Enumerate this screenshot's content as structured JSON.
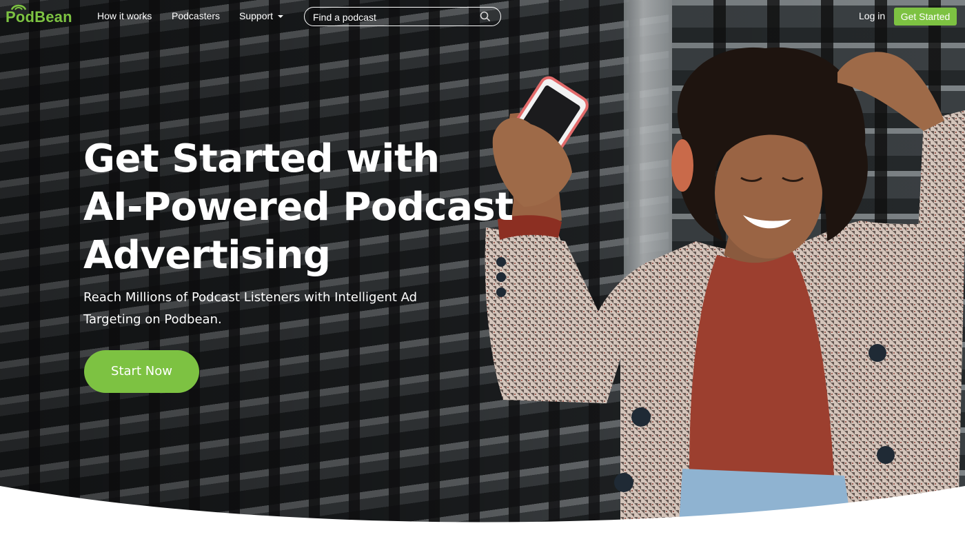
{
  "brand": {
    "name": "PodBean",
    "color": "#7dc242"
  },
  "nav": {
    "links": [
      {
        "label": "How it works"
      },
      {
        "label": "Podcasters"
      },
      {
        "label": "Support"
      }
    ],
    "search": {
      "placeholder": "Find a podcast",
      "icon": "search-icon"
    },
    "login_label": "Log in",
    "get_started_label": "Get Started"
  },
  "hero": {
    "headline_lines": [
      "Get Started with",
      "AI-Powered Podcast",
      "Advertising"
    ],
    "subheadline": "Reach Millions of Podcast Listeners with Intelligent Ad Targeting on Podbean.",
    "cta_label": "Start Now"
  },
  "colors": {
    "accent": "#7dc242",
    "text_on_hero": "#ffffff"
  }
}
